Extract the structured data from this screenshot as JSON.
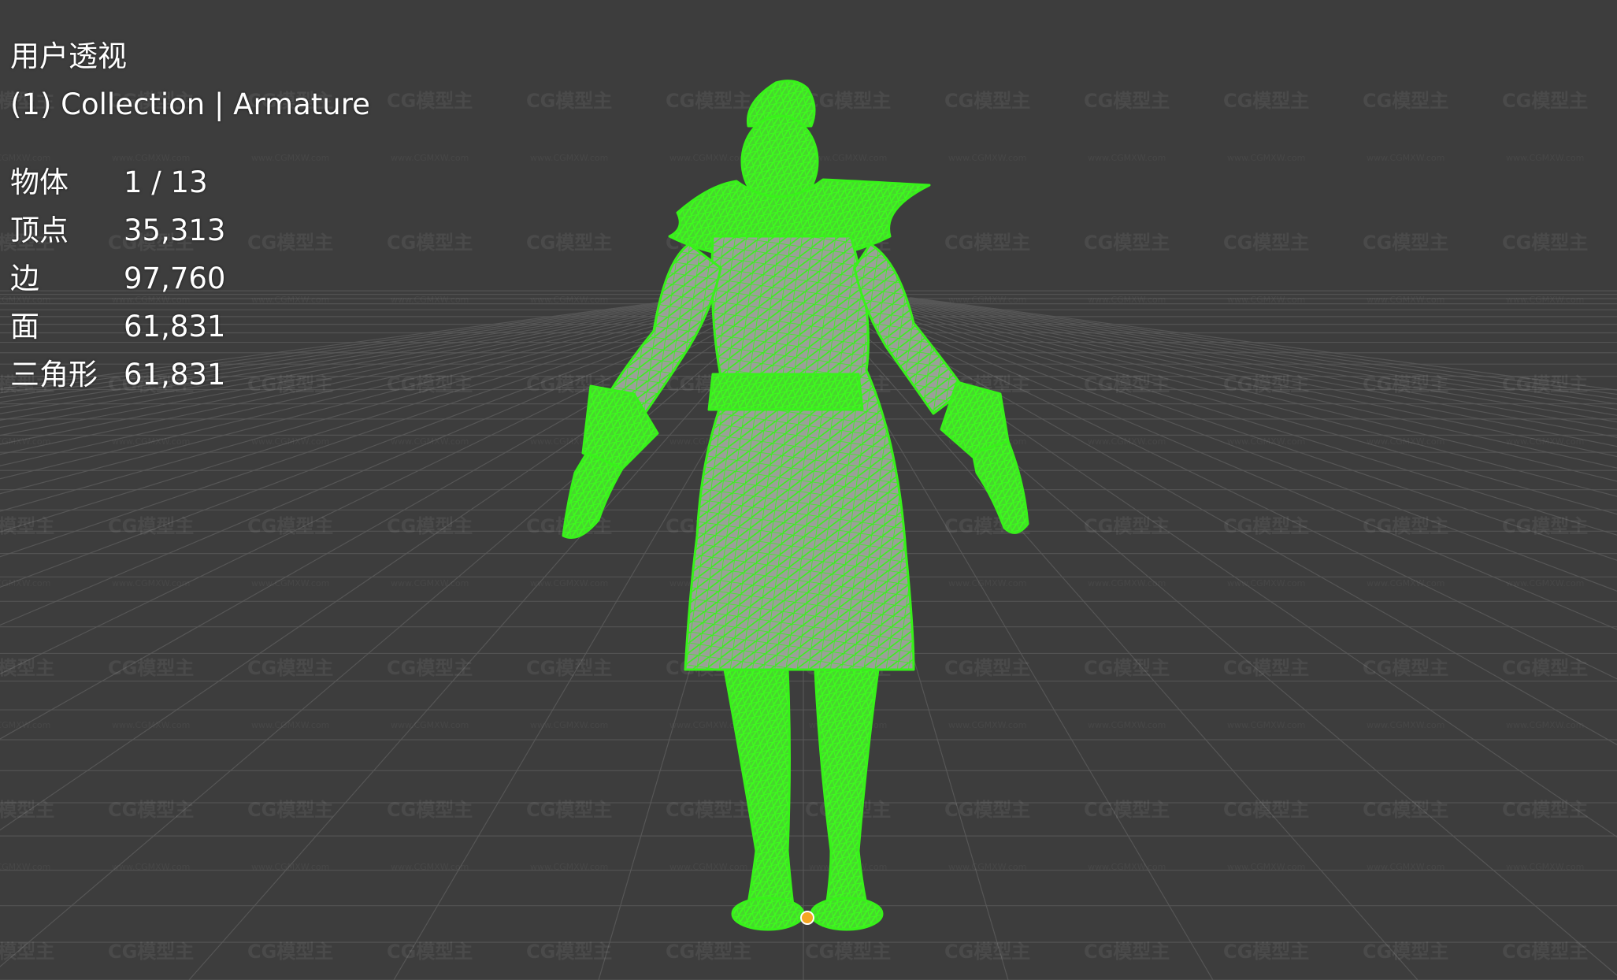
{
  "viewport": {
    "view_name": "用户透视",
    "collection_info": "(1) Collection | Armature",
    "stats": [
      {
        "label": "物体",
        "value": "1 / 13"
      },
      {
        "label": "顶点",
        "value": "35,313"
      },
      {
        "label": "边",
        "value": "97,760"
      },
      {
        "label": "面",
        "value": "61,831"
      },
      {
        "label": "三角形",
        "value": "61,831"
      }
    ]
  },
  "watermark": {
    "brand": "CG模型主",
    "url": "www.CGMXW.com"
  },
  "colors": {
    "background": "#3d3d3d",
    "grid_line": "#595959",
    "wireframe": "#38f21a",
    "mesh_fill": "#9aa197",
    "origin_point": "#f5a623",
    "overlay_text": "#ffffff"
  },
  "icons": {
    "origin": "object-origin-dot"
  }
}
